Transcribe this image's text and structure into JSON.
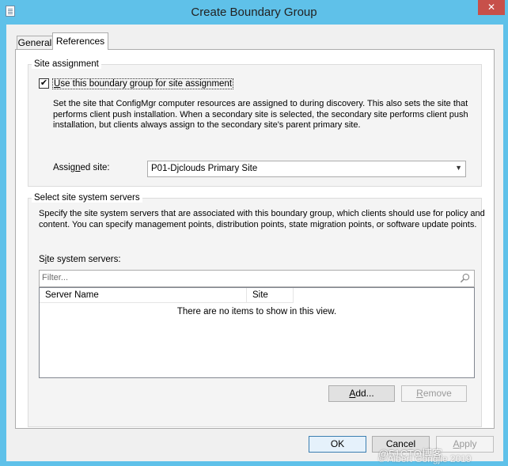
{
  "window": {
    "title": "Create Boundary Group",
    "close_glyph": "✕",
    "icon": "window-app-icon"
  },
  "tabs": [
    {
      "label": "General",
      "selected": false
    },
    {
      "label": "References",
      "selected": true
    }
  ],
  "site_assignment": {
    "group_label": "Site assignment",
    "checkbox_checked": true,
    "checkbox_glyph": "✔",
    "checkbox_label_pre": "U",
    "checkbox_label_rest": "se this boundary group for site assignment",
    "description_lines": [
      "Set the site that ConfigMgr computer resources are assigned to during discovery. This also sets the site that",
      "performs client push installation. When a secondary site is selected, the secondary site performs client push",
      "installation, but clients always assign to the secondary site's parent primary site."
    ],
    "assigned_site_label_pre": "Assig",
    "assigned_site_label_u": "n",
    "assigned_site_label_post": "ed site:",
    "assigned_site_value": "P01-Djclouds Primary Site",
    "dropdown_arrow": "▼"
  },
  "site_servers": {
    "group_label": "Select site system servers",
    "description_lines": [
      "Specify the site system servers that are associated with this boundary group, which clients should use for policy and",
      "content. You can specify management points, distribution points, state migration points, or software update points."
    ],
    "list_label_pre": "S",
    "list_label_u": "i",
    "list_label_post": "te system servers:",
    "filter_placeholder": "Filter...",
    "columns": [
      "Server Name",
      "Site"
    ],
    "empty_message": "There are no items to show in this view.",
    "add_pre": "",
    "add_u": "A",
    "add_post": "dd...",
    "remove_pre": "",
    "remove_u": "R",
    "remove_post": "emove"
  },
  "footer": {
    "ok": "OK",
    "cancel": "Cancel",
    "apply_pre": "",
    "apply_u": "A",
    "apply_post": "pply"
  },
  "watermark": "@51CTO博客",
  "watermark_under": "© Albert Gongjie 2019"
}
